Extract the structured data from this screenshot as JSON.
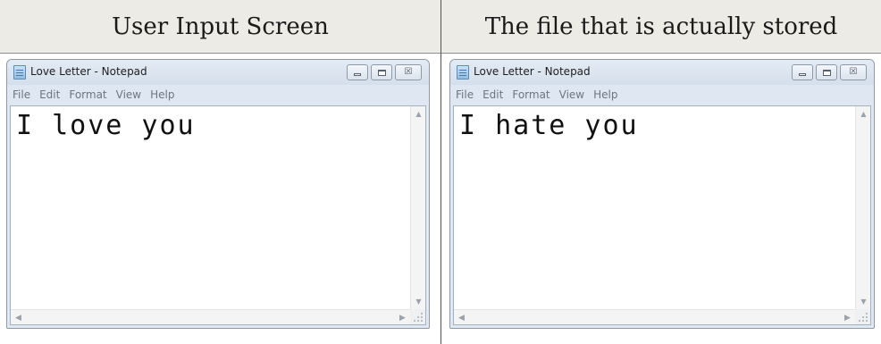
{
  "headers": {
    "left": "User Input Screen",
    "right": "The file that is actually stored"
  },
  "windows": [
    {
      "title": "Love Letter - Notepad",
      "menu": [
        "File",
        "Edit",
        "Format",
        "View",
        "Help"
      ],
      "content": "I love you"
    },
    {
      "title": "Love Letter - Notepad",
      "menu": [
        "File",
        "Edit",
        "Format",
        "View",
        "Help"
      ],
      "content": "I hate you"
    }
  ],
  "window_controls": {
    "minimize": "minimize",
    "maximize": "maximize",
    "close": "☒"
  },
  "icons": [
    "notepad-icon",
    "minimize-icon",
    "maximize-icon",
    "close-icon",
    "scroll-up-icon",
    "scroll-down-icon",
    "scroll-left-icon",
    "scroll-right-icon",
    "resize-grip-icon"
  ]
}
